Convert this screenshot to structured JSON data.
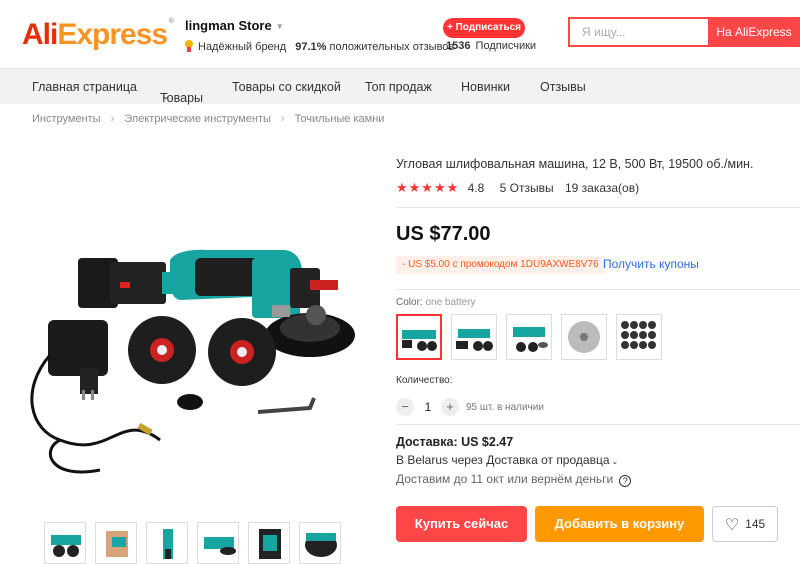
{
  "header": {
    "logo_part1": "Ali",
    "logo_part2": "Express",
    "logo_mark": "®",
    "store_name": "lingman Store",
    "brand_badge": "Надёжный бренд",
    "positive_percent": "97.1%",
    "positive_label": "положительных отзывов",
    "subscribe_label": "+ Подписаться",
    "subscribers_count": "1536",
    "subscribers_label": "Подписчики",
    "search_placeholder": "Я ищу...",
    "search_button": "На AliExpress"
  },
  "nav": {
    "items": [
      {
        "label": "Главная страница"
      },
      {
        "label": "Товары",
        "dropdown": true
      },
      {
        "label": "Товары со скидкой"
      },
      {
        "label": "Топ продаж"
      },
      {
        "label": "Новинки"
      },
      {
        "label": "Отзывы"
      }
    ]
  },
  "breadcrumb": [
    "Инструменты",
    "Электрические инструменты",
    "Точильные камни"
  ],
  "product": {
    "title": "Угловая шлифовальная машина, 12 В, 500 Вт, 19500 об./мин.",
    "stars": "★★★★★",
    "rating": "4.8",
    "reviews": "5 Отзывы",
    "orders": "19 заказа(ов)",
    "price": "US $77.00",
    "coupon": "- US $5.00 с промокодом 1DU9AXWE8V76",
    "coupon_link": "Получить купоны",
    "color_label": "Color:",
    "color_value": "one battery",
    "quantity_label": "Количество:",
    "quantity": "1",
    "stock": "95 шт. в наличии",
    "shipping_title": "Доставка: US $2.47",
    "shipping_route": "В Belarus через Доставка от продавца",
    "shipping_eta": "Доставим до 11 окт или вернём деньги",
    "buy_now": "Купить сейчас",
    "add_to_cart": "Добавить в корзину",
    "wishlist_count": "145"
  },
  "colors": {
    "accent": "#ff4747",
    "cart": "#ff9900",
    "link": "#2f6ee0",
    "tool_teal": "#16a5a0"
  }
}
